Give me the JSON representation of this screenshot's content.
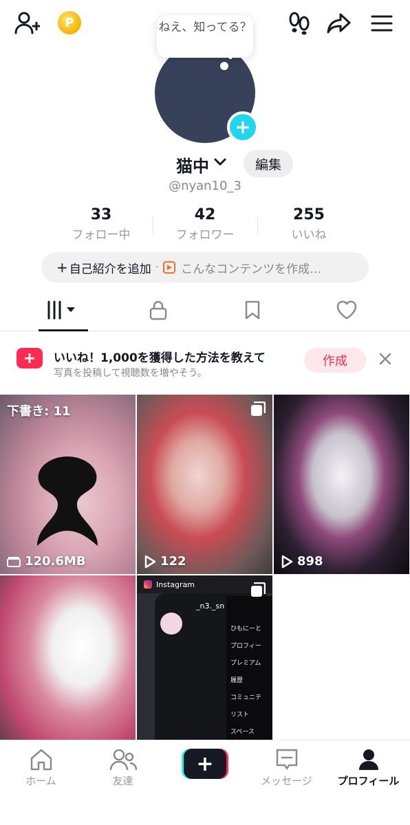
{
  "header": {
    "bubble_text": "ねえ、知ってる？",
    "coin_symbol": "P"
  },
  "profile": {
    "name": "猫中",
    "edit_label": "編集",
    "handle": "@nyan10_3",
    "avatar_color": "#37415a",
    "accent": "#20d5ec"
  },
  "stats": [
    {
      "value": "33",
      "label": "フォロー中"
    },
    {
      "value": "42",
      "label": "フォロワー"
    },
    {
      "value": "255",
      "label": "いいね"
    }
  ],
  "bio": {
    "add_label": "自己紹介を追加",
    "separator": "·",
    "content_label": "こんなコンテンツを作成…"
  },
  "tabs": [
    {
      "icon": "videos-grid-icon",
      "active": true
    },
    {
      "icon": "lock-icon",
      "active": false
    },
    {
      "icon": "bookmark-icon",
      "active": false
    },
    {
      "icon": "heart-icon",
      "active": false
    }
  ],
  "promo": {
    "title": "いいね！1,000を獲得した方法を教えて",
    "subtitle": "写真を投稿して視聴数を増やそう。",
    "button": "作成",
    "accent": "#fe2c55"
  },
  "videos": [
    {
      "type": "draft",
      "draft_label": "下書き: 11",
      "meta": "120.6MB"
    },
    {
      "type": "video",
      "views": "122",
      "multi": true
    },
    {
      "type": "video",
      "views": "898",
      "multi": false
    },
    {
      "type": "video",
      "views": "",
      "multi": false
    },
    {
      "type": "photo",
      "source_label": "Instagram",
      "multi": true,
      "panel_name": "_n3._sn",
      "side_name": "ひもにーと",
      "side_items": [
        "プロフィー",
        "プレミアム",
        "履歴",
        "コミュニテ",
        "リスト",
        "スペース"
      ]
    }
  ],
  "nav": [
    {
      "label": "ホーム",
      "icon": "home-icon",
      "active": false
    },
    {
      "label": "友達",
      "icon": "friends-icon",
      "active": false
    },
    {
      "label": "",
      "icon": "create-plus-icon",
      "active": false
    },
    {
      "label": "メッセージ",
      "icon": "inbox-icon",
      "active": false
    },
    {
      "label": "プロフィール",
      "icon": "profile-icon",
      "active": true
    }
  ]
}
